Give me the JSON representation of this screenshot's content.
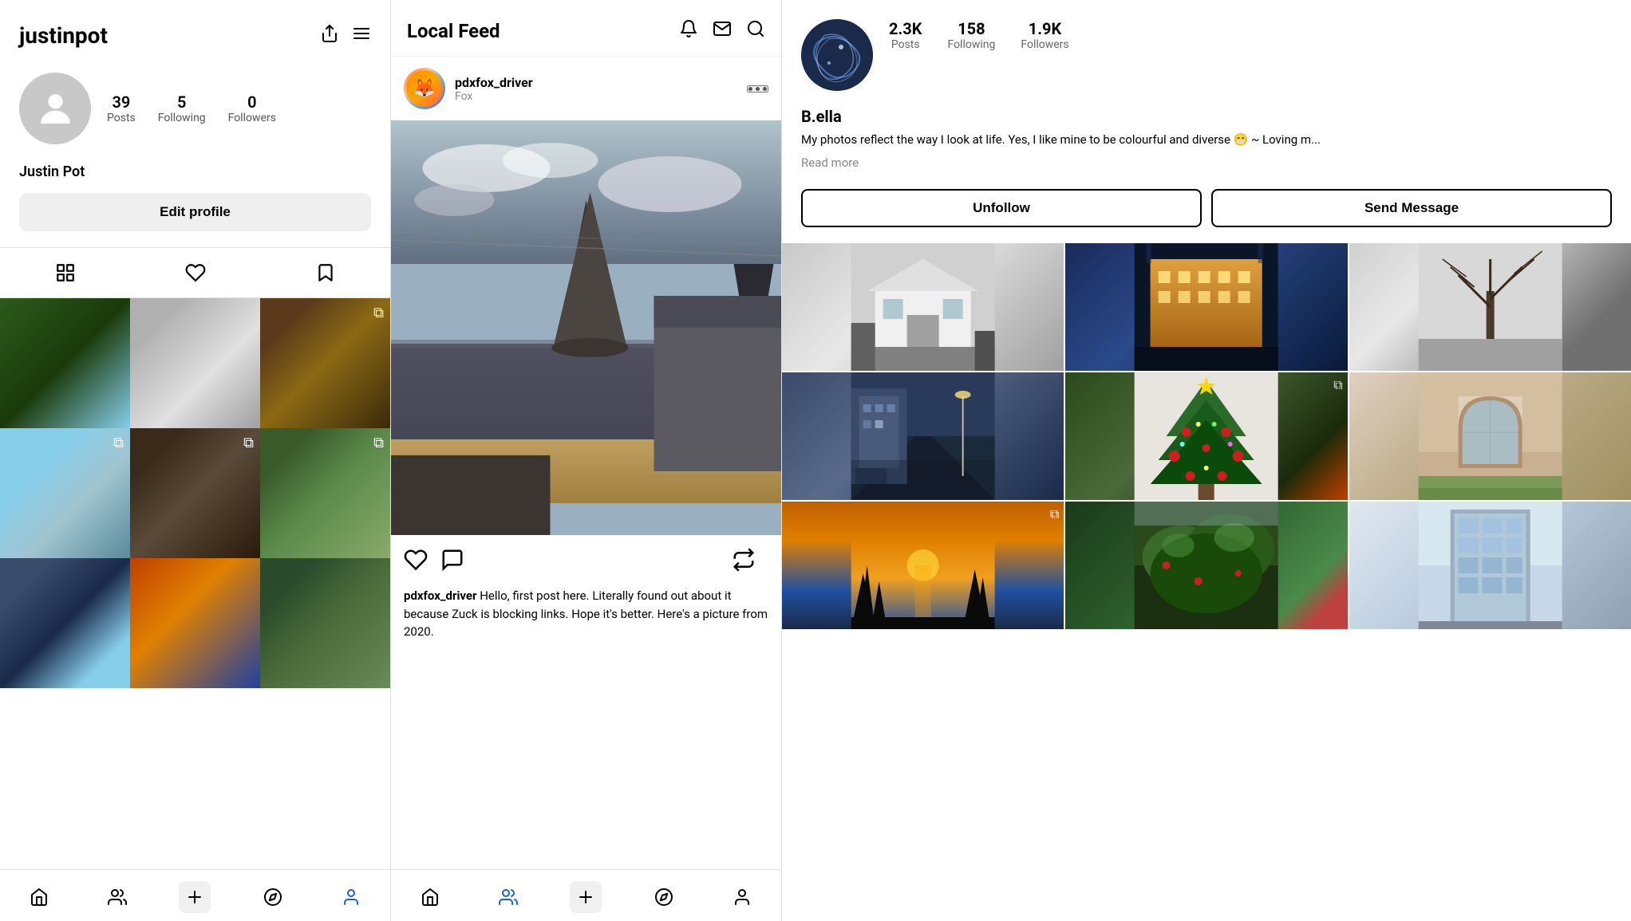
{
  "left": {
    "username": "justinpot",
    "display_name": "Justin Pot",
    "stats": {
      "posts": "39",
      "posts_label": "Posts",
      "following": "5",
      "following_label": "Following",
      "followers": "0",
      "followers_label": "Followers"
    },
    "edit_profile_label": "Edit profile",
    "tabs": [
      "grid",
      "heart",
      "bookmark"
    ],
    "bottom_nav": [
      "home",
      "people",
      "plus",
      "explore",
      "profile"
    ]
  },
  "middle": {
    "title": "Local Feed",
    "post": {
      "username": "pdxfox_driver",
      "instance": "Fox",
      "caption_username": "pdxfox_driver",
      "caption_text": " Hello, first post here. Literally found out about it because Zuck is blocking links. Hope it's better. Here's a picture from 2020."
    },
    "bottom_nav": [
      "home",
      "people",
      "plus",
      "explore",
      "profile"
    ]
  },
  "right": {
    "stats": {
      "posts": "2.3K",
      "posts_label": "Posts",
      "following": "158",
      "following_label": "Following",
      "followers": "1.9K",
      "followers_label": "Followers"
    },
    "username": "B.ella",
    "bio": "My photos reflect the way I look at life. Yes, I like mine to be colourful and diverse 😁 ~ Loving m...",
    "read_more": "Read more",
    "unfollow_label": "Unfollow",
    "send_message_label": "Send Message"
  }
}
